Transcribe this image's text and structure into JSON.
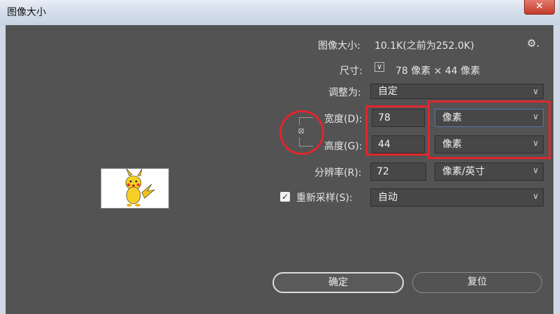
{
  "window": {
    "title": "图像大小",
    "close_glyph": "✕"
  },
  "summary": {
    "image_size_label": "图像大小:",
    "image_size_value": "10.1K(之前为252.0K)",
    "dimensions_label": "尺寸:",
    "dimensions_value": "78 像素 × 44 像素",
    "gear_icon": "⚙."
  },
  "adjust": {
    "label": "调整为:",
    "value": "自定"
  },
  "width": {
    "label": "宽度(D):",
    "value": "78",
    "unit": "像素"
  },
  "height": {
    "label": "高度(G):",
    "value": "44",
    "unit": "像素"
  },
  "resolution": {
    "label": "分辨率(R):",
    "value": "72",
    "unit": "像素/英寸"
  },
  "resample": {
    "checked": true,
    "label": "重新采样(S):",
    "value": "自动"
  },
  "buttons": {
    "ok": "确定",
    "reset": "复位"
  },
  "colors": {
    "highlight": "#e0262b",
    "panel": "#535353",
    "focus_border": "#4f76b5"
  }
}
